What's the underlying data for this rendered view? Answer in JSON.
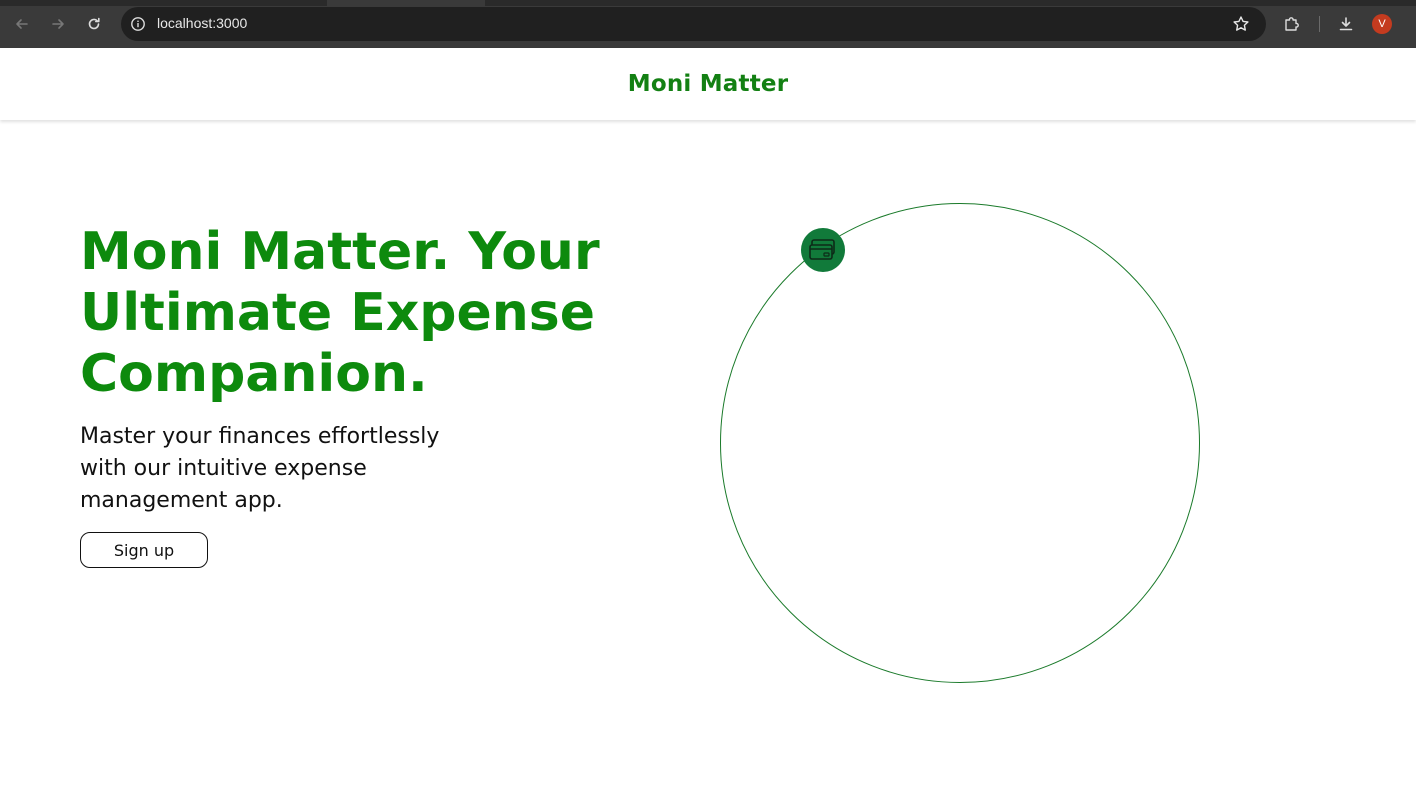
{
  "browser": {
    "url": "localhost:3000",
    "avatar_letter": "V",
    "icons": {
      "back": "arrow-left-icon",
      "forward": "arrow-right-icon",
      "reload": "reload-icon",
      "site_info": "info-icon",
      "bookmark": "star-icon",
      "extensions": "puzzle-icon",
      "downloads": "download-icon"
    }
  },
  "header": {
    "brand": "Moni Matter"
  },
  "hero": {
    "title_lines": [
      "Moni Matter. Your",
      "Ultimate Expense",
      "Companion."
    ],
    "subtitle_lines": [
      "Master your finances effortlessly",
      "with our intuitive expense",
      "management app."
    ],
    "signup_label": "Sign up"
  },
  "orbit": {
    "badge_icon": "credit-cards-icon"
  },
  "colors": {
    "brand_green": "#138013",
    "title_green": "#0d8a0d",
    "badge_green": "#117a3a",
    "orbit_stroke": "#1a7a2a",
    "avatar": "#c43b1f"
  }
}
